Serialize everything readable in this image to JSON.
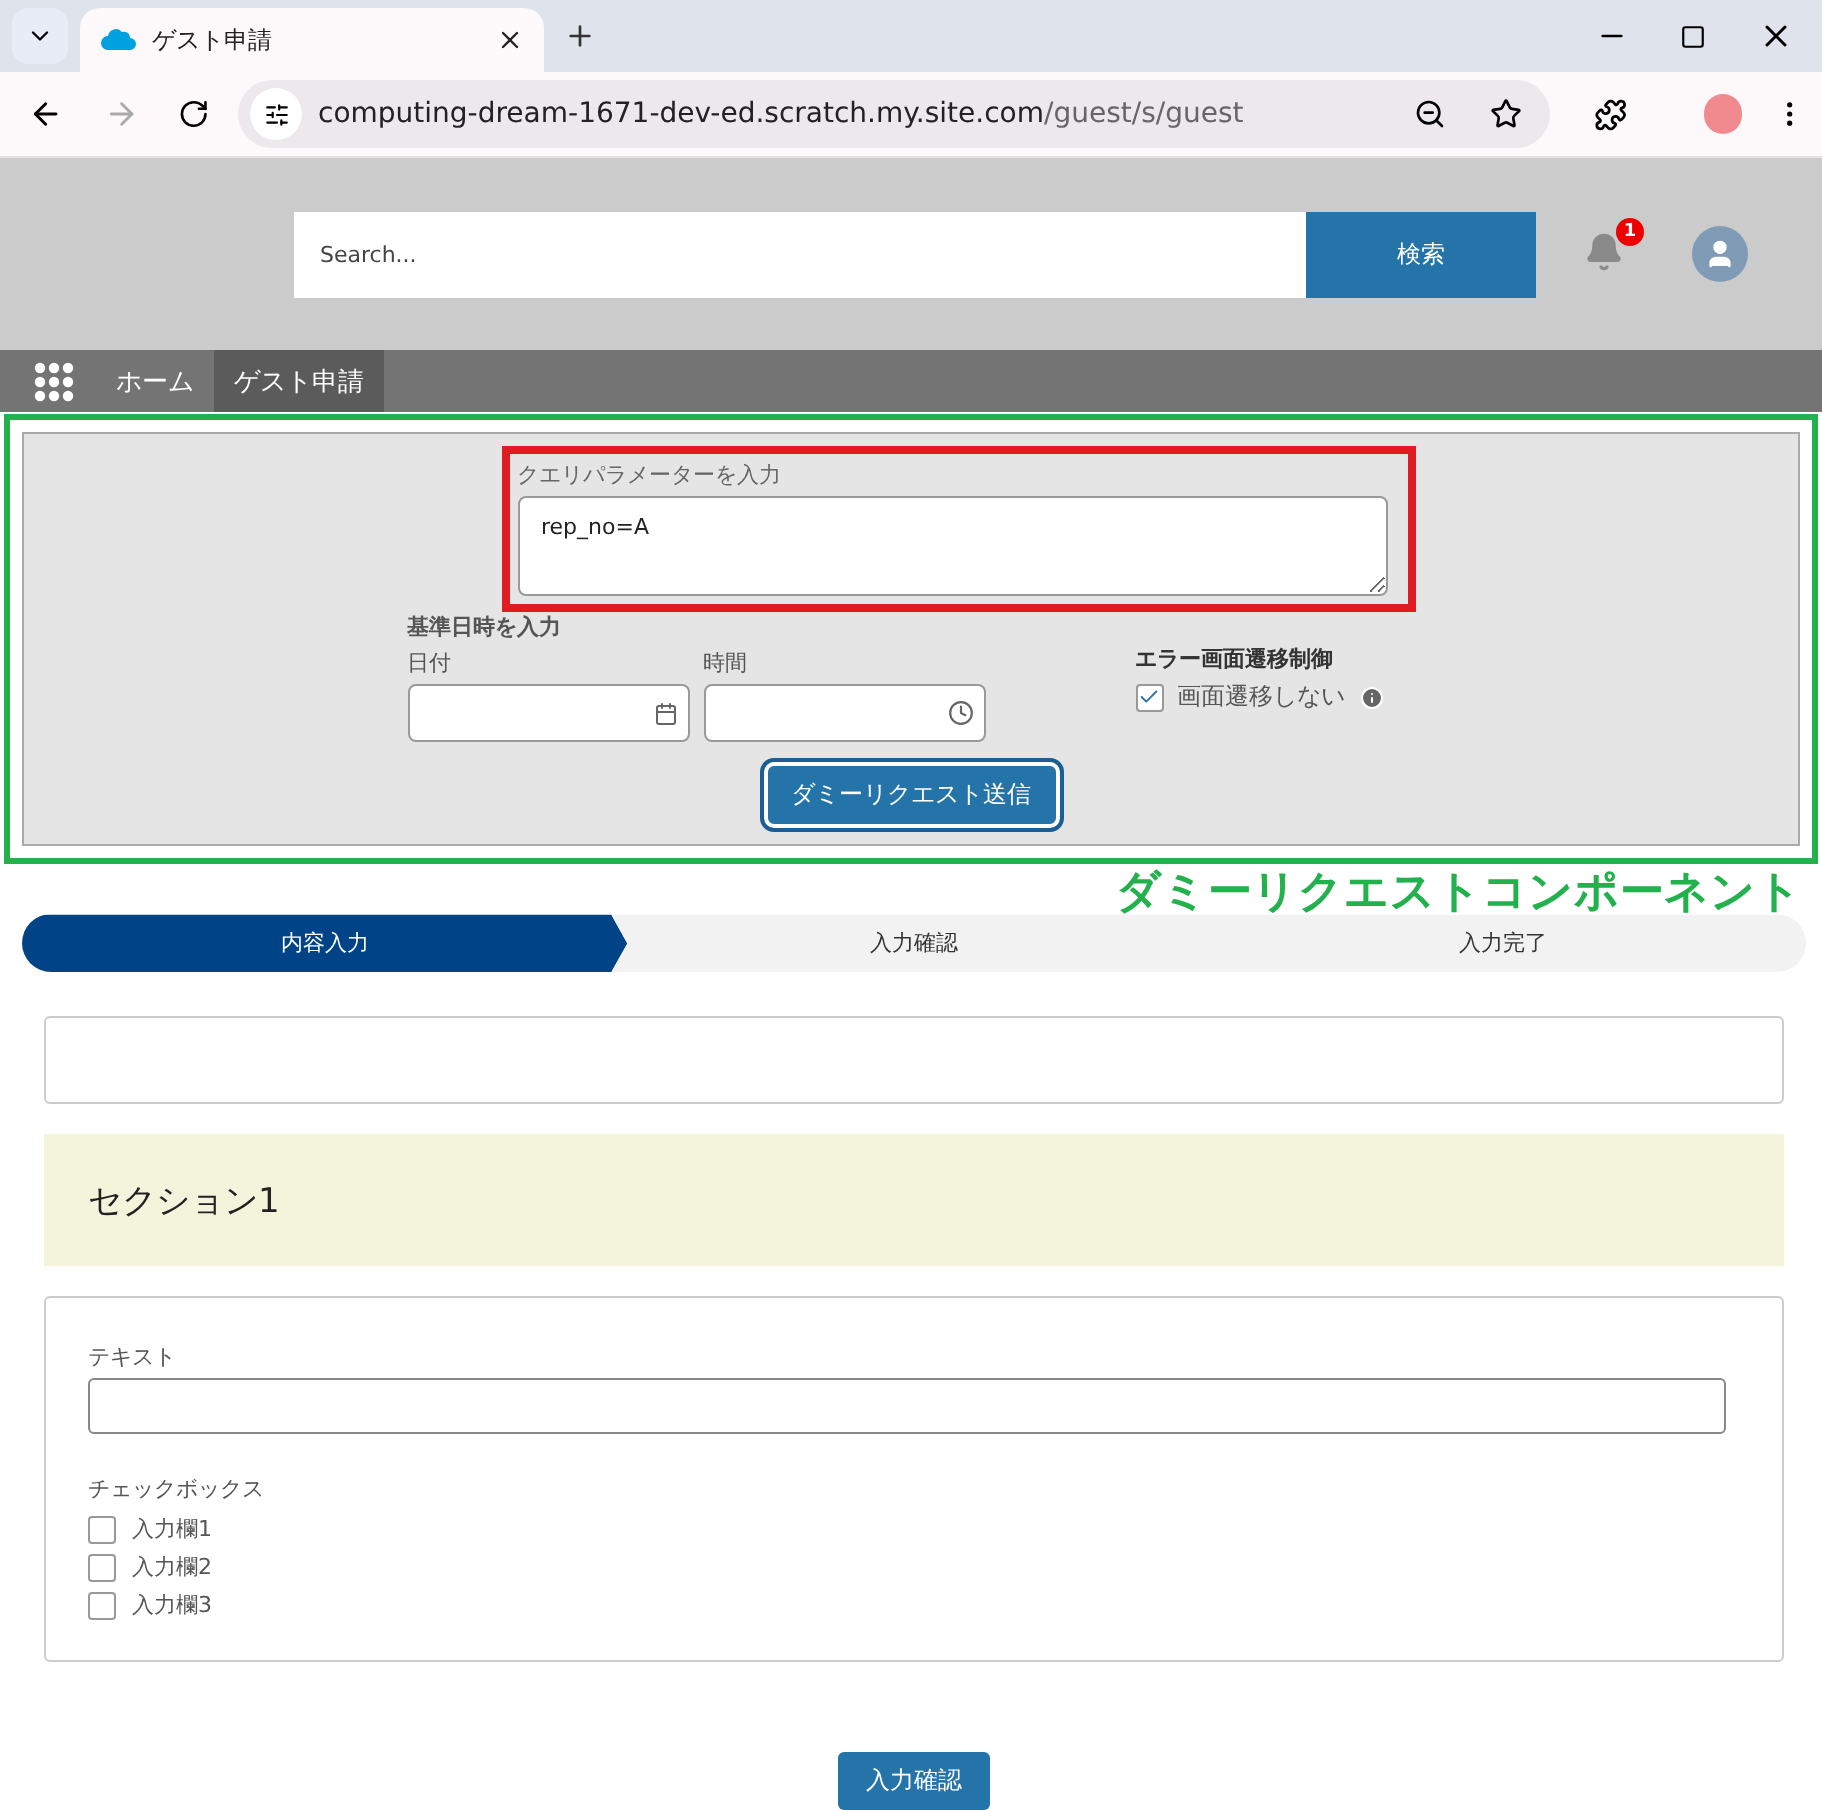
{
  "browser": {
    "tab_title": "ゲスト申請",
    "url_host": "computing-dream-1671-dev-ed.scratch.my.site.com",
    "url_path": "/guest/s/guest"
  },
  "header": {
    "search_placeholder": "Search...",
    "search_button": "検索",
    "notification_count": "1"
  },
  "nav": [
    {
      "label": "ホーム",
      "selected": false
    },
    {
      "label": "ゲスト申請",
      "selected": true
    }
  ],
  "dummy_panel": {
    "query_label": "クエリパラメーターを入力",
    "query_value": "rep_no=A",
    "datetime_heading": "基準日時を入力",
    "date_label": "日付",
    "time_label": "時間",
    "error_heading": "エラー画面遷移制御",
    "error_option": "画面遷移しない",
    "error_checked": true,
    "submit": "ダミーリクエスト送信"
  },
  "annotation": "ダミーリクエストコンポーネント",
  "steps": [
    {
      "label": "内容入力",
      "selected": true
    },
    {
      "label": "入力確認",
      "selected": false
    },
    {
      "label": "入力完了",
      "selected": false
    }
  ],
  "section_title": "セクション1",
  "form": {
    "text_label": "テキスト",
    "checkbox_label": "チェックボックス",
    "options": [
      {
        "label": "入力欄1",
        "checked": false
      },
      {
        "label": "入力欄2",
        "checked": false
      },
      {
        "label": "入力欄3",
        "checked": false
      }
    ]
  },
  "confirm_button": "入力確認"
}
